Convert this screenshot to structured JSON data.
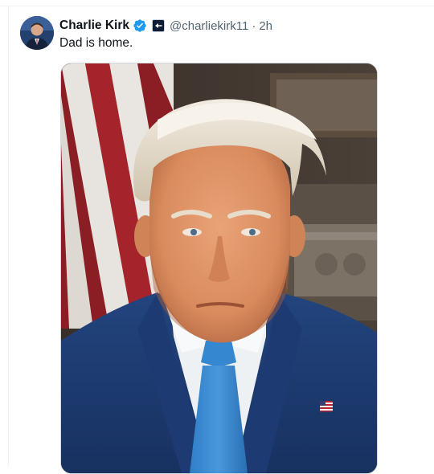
{
  "post": {
    "author": {
      "display_name": "Charlie Kirk",
      "handle": "@charliekirk11",
      "verified": true,
      "verified_icon": "verified-badge-icon",
      "affiliation_icon": "affiliation-badge-icon"
    },
    "separator": "·",
    "timestamp": "2h",
    "text": "Dad is home.",
    "media": {
      "type": "photo",
      "description_icon": "portrait-photo"
    }
  },
  "colors": {
    "verified_blue": "#1d9bf0",
    "secondary_text": "#536471",
    "primary_text": "#0f1419",
    "border": "#cfd9de"
  }
}
